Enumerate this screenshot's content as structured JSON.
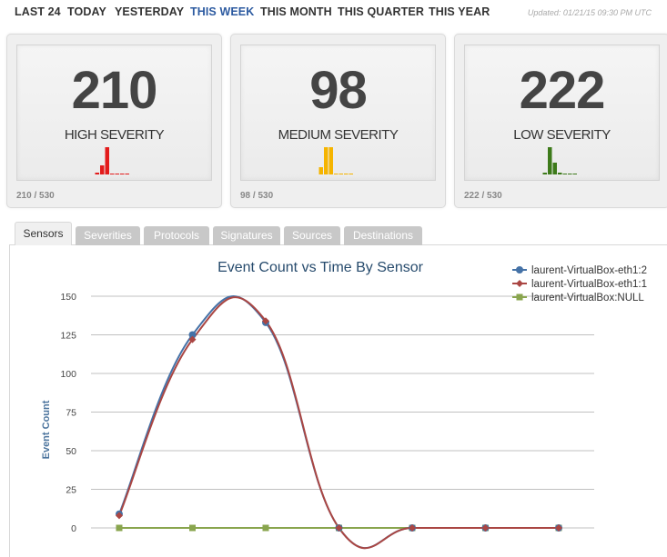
{
  "nav": {
    "items": [
      "LAST 24",
      "TODAY",
      "YESTERDAY",
      "THIS WEEK",
      "THIS MONTH",
      "THIS QUARTER",
      "THIS YEAR"
    ],
    "active": "THIS WEEK",
    "updated": "Updated: 01/21/15 09:30 PM UTC"
  },
  "cards": [
    {
      "value": "210",
      "label": "HIGH SEVERITY",
      "ratio": "210 / 530",
      "color": "#e31b1b",
      "spark": [
        2,
        10,
        38,
        1,
        1,
        1,
        1
      ]
    },
    {
      "value": "98",
      "label": "MEDIUM SEVERITY",
      "ratio": "98 / 530",
      "color": "#f5b400",
      "spark": [
        8,
        38,
        38,
        1,
        1,
        1,
        1
      ]
    },
    {
      "value": "222",
      "label": "LOW SEVERITY",
      "ratio": "222 / 530",
      "color": "#3d7a1a",
      "spark": [
        2,
        38,
        13,
        2,
        1,
        1,
        1
      ]
    }
  ],
  "tabs": [
    "Sensors",
    "Severities",
    "Protocols",
    "Signatures",
    "Sources",
    "Destinations"
  ],
  "active_tab": "Sensors",
  "chart_data": {
    "type": "line",
    "title": "Event Count vs Time By Sensor",
    "ylabel": "Event Count",
    "xlabel": "",
    "ylim": [
      0,
      150
    ],
    "yticks": [
      0,
      25,
      50,
      75,
      100,
      125,
      150
    ],
    "grid": true,
    "legend": "top-right",
    "x": [
      1,
      2,
      3,
      4,
      5,
      6,
      7
    ],
    "series": [
      {
        "name": "laurent-VirtualBox-eth1:2",
        "color": "#4572a7",
        "marker": "circle",
        "values": [
          9,
          125,
          133,
          0,
          0,
          0,
          0
        ]
      },
      {
        "name": "laurent-VirtualBox-eth1:1",
        "color": "#aa4643",
        "marker": "diamond",
        "values": [
          8,
          122,
          134,
          0,
          0,
          0,
          0
        ]
      },
      {
        "name": "laurent-VirtualBox:NULL",
        "color": "#89a54e",
        "marker": "square",
        "values": [
          0,
          0,
          0,
          0,
          0,
          0,
          0
        ]
      }
    ]
  }
}
